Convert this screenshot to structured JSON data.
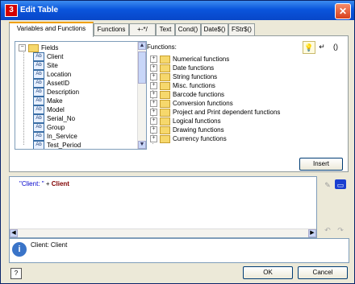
{
  "window": {
    "title": "Edit Table",
    "app_icon": "3"
  },
  "tabs": [
    "Variables and Functions",
    "Functions",
    "+-*/",
    "Text",
    "Cond()",
    "Date$()",
    "FStr$()"
  ],
  "fields": {
    "root": "Fields",
    "items": [
      "Client",
      "Site",
      "Location",
      "AssetID",
      "Description",
      "Make",
      "Model",
      "Serial_No",
      "Group",
      "In_Service",
      "Test_Period"
    ]
  },
  "functions": {
    "label": "Functions:",
    "items": [
      "Numerical functions",
      "Date functions",
      "String functions",
      "Misc. functions",
      "Barcode functions",
      "Conversion functions",
      "Project and Print dependent functions",
      "Logical functions",
      "Drawing functions",
      "Currency functions"
    ]
  },
  "toolbar": {
    "bulb_icon": "lightbulb-icon",
    "enter_symbol": "↵",
    "parens_label": "()"
  },
  "insert_label": "Insert",
  "expression": {
    "string_part": "\"Client:  \"",
    "operator": "+",
    "field_part": "Client"
  },
  "info": {
    "text": "Client:   Client"
  },
  "ok_label": "OK",
  "cancel_label": "Cancel",
  "help_label": "?"
}
